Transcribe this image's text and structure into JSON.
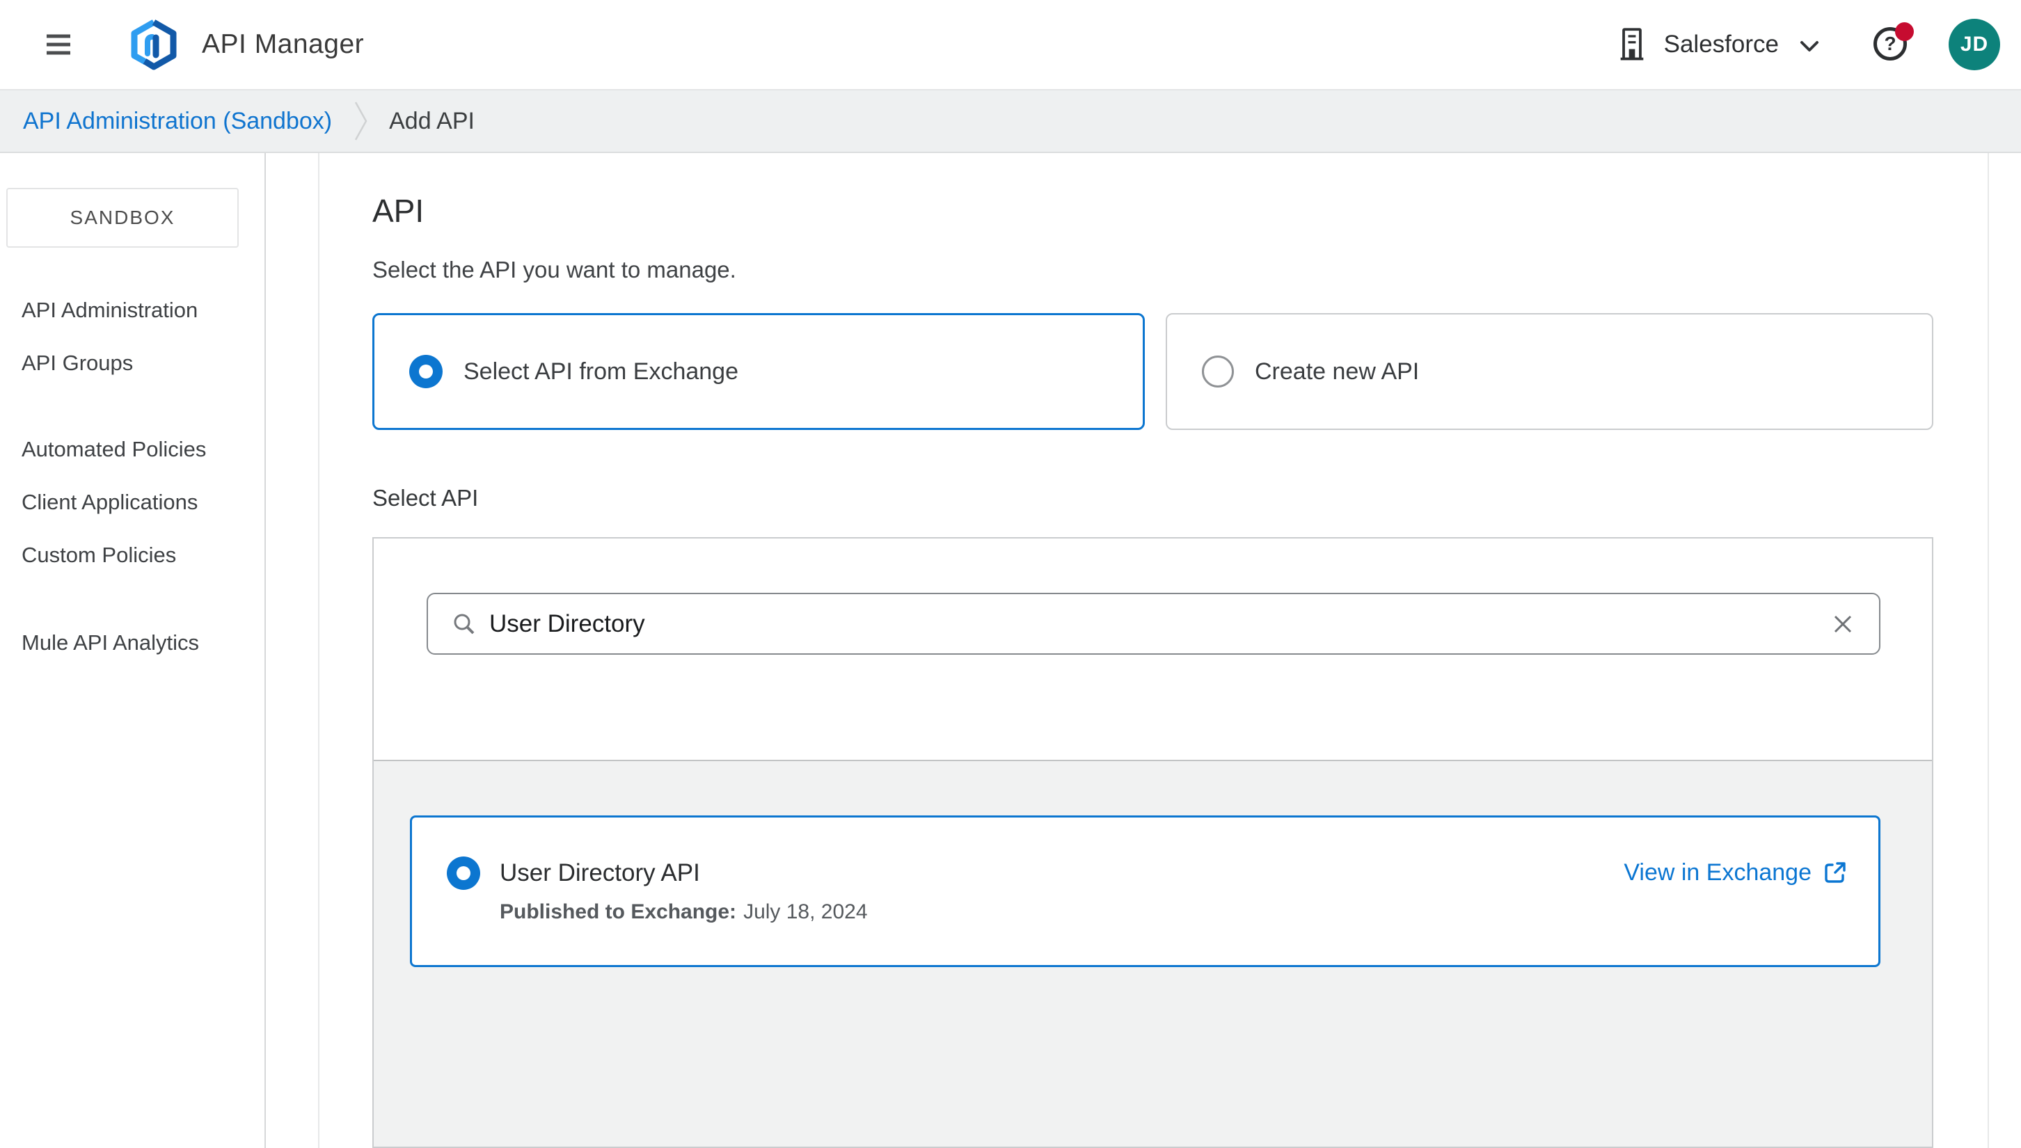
{
  "header": {
    "app_title": "API Manager",
    "org_name": "Salesforce",
    "avatar_initials": "JD"
  },
  "breadcrumb": {
    "items": [
      {
        "label": "API Administration (Sandbox)"
      },
      {
        "label": "Add API"
      }
    ]
  },
  "sidebar": {
    "environment_label": "SANDBOX",
    "items": [
      {
        "label": "API Administration"
      },
      {
        "label": "API Groups"
      },
      {
        "label": "Automated Policies"
      },
      {
        "label": "Client Applications"
      },
      {
        "label": "Custom Policies"
      },
      {
        "label": "Mule API Analytics"
      }
    ]
  },
  "main": {
    "title": "API",
    "subtitle": "Select the API you want to manage.",
    "source_options": [
      {
        "label": "Select API from Exchange",
        "selected": true
      },
      {
        "label": "Create new API",
        "selected": false
      }
    ],
    "select_api_label": "Select API",
    "search": {
      "value": "User Directory"
    },
    "result": {
      "name": "User Directory API",
      "published_label": "Published to Exchange:",
      "published_date": "July 18, 2024",
      "link_label": "View in Exchange",
      "selected": true
    }
  },
  "colors": {
    "accent_blue": "#0C76D0",
    "link_blue": "#0B76D2",
    "notification_red": "#C60C30",
    "avatar_teal": "#0D827B",
    "logo_light_blue": "#2F9DF0",
    "logo_dark_blue": "#1259A8"
  }
}
